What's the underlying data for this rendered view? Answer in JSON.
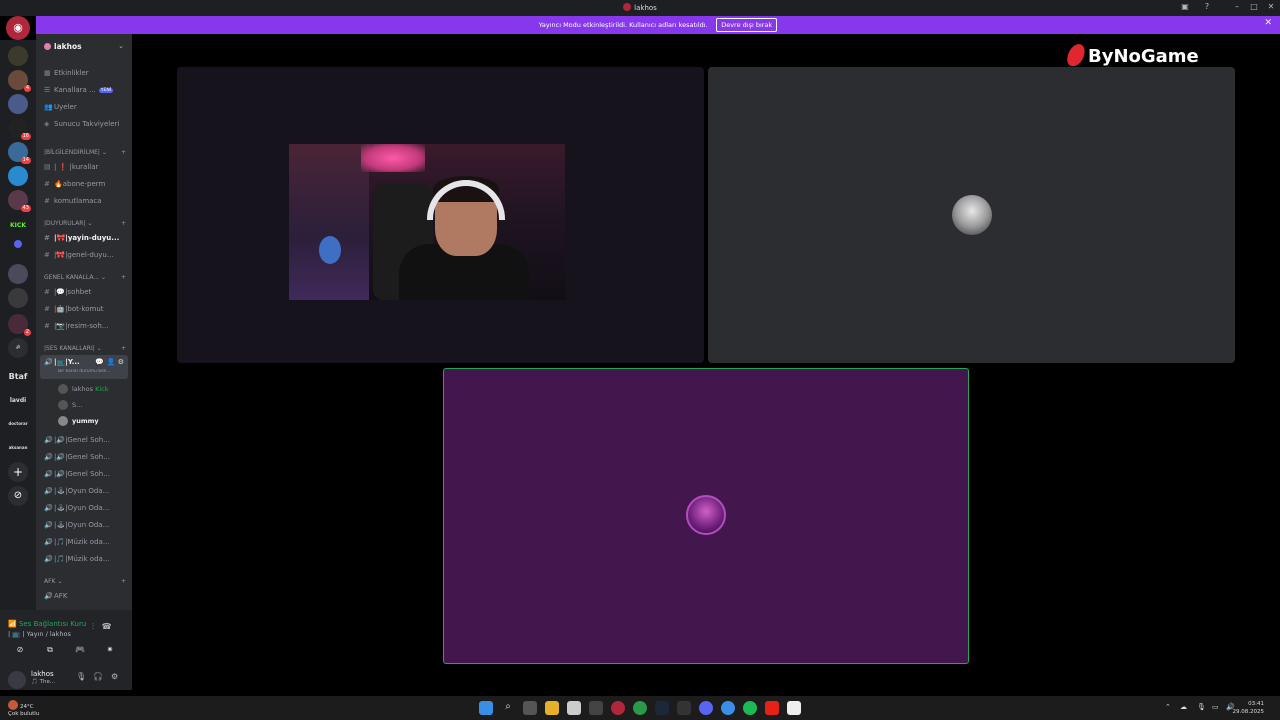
{
  "window": {
    "title": "lakhos"
  },
  "banner": {
    "message": "Yayıncı Modu etkinleştirildi. Kullanıcı adları kesatıldı.",
    "button": "Devre dışı bırak"
  },
  "server_rail": {
    "text_servers": [
      "Btaf",
      "lavdi",
      "doctorar",
      "aksanan"
    ],
    "badges": [
      "4",
      "16",
      "14",
      "43",
      "2"
    ]
  },
  "sidebar": {
    "server_name": "lakhos",
    "top_items": [
      {
        "label": "Etkinlikler",
        "icon": "calendar-icon"
      },
      {
        "label": "Kanallara ...",
        "icon": "channels-icon",
        "badge": "YENİ"
      },
      {
        "label": "Üyeler",
        "icon": "members-icon"
      },
      {
        "label": "Sunucu Takviyeleri",
        "icon": "boost-icon"
      }
    ],
    "categories": [
      {
        "name": "|BİLGİLENDİRİLME|",
        "channels": [
          "| ❗ |kurallar",
          "🔥abone-perm",
          "komutlamaca"
        ]
      },
      {
        "name": "|DUYURULAR|",
        "channels": [
          "|🎀|yayin-duyu...",
          "|🎀|genel-duyu..."
        ]
      },
      {
        "name": "GENEL KANALLA...",
        "channels": [
          "|💬|sohbet",
          "|🤖|bot-komut",
          "|📷|resim-soh..."
        ]
      },
      {
        "name": "|SES KANALLARI|",
        "channels": []
      },
      {
        "name": "AFK",
        "channels": []
      }
    ],
    "active_voice": {
      "name": "|📺|Y...",
      "status": "Bir kanal durumu beli..."
    },
    "voice_members": [
      {
        "name": "lakhos",
        "tag": "Kick"
      },
      {
        "name": "S...",
        "tag": ""
      },
      {
        "name": "yummy",
        "tag": ""
      }
    ],
    "voice_channels": [
      "|🔊|Genel Soh...",
      "|🔊|Genel Soh...",
      "|🔊|Genel Soh...",
      "|🕹|Oyun Oda...",
      "|🕹|Oyun Oda...",
      "|🕹|Oyun Oda...",
      "|🎵|Müzik oda...",
      "|🎵|Müzik oda..."
    ],
    "afk_channel": "AFK"
  },
  "voice_panel": {
    "status": "Ses Bağlantısı Kuru",
    "location": "| 📺 | Yayın / lakhos"
  },
  "user_panel": {
    "username": "lakhos",
    "activity": "🎵 The..."
  },
  "watermark": "ByNoGame",
  "taskbar": {
    "weather_temp": "24°C",
    "weather_desc": "Çok bulutlu",
    "time": "03:41",
    "date": "29.08.2025"
  }
}
